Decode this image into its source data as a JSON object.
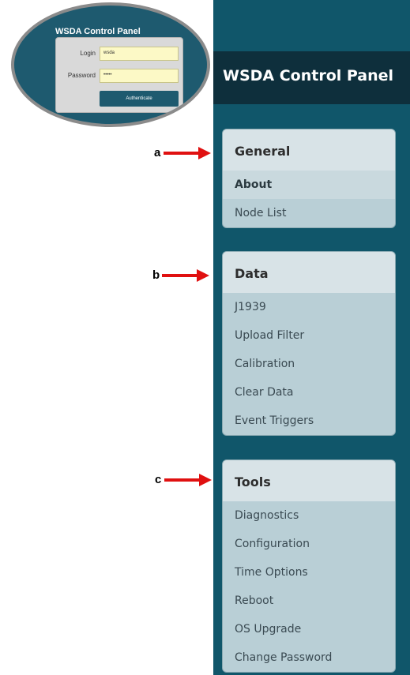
{
  "login_inset": {
    "title": "WSDA Control Panel",
    "login_label": "Login",
    "login_value": "wsda",
    "password_label": "Password",
    "password_value": "•••••",
    "button_label": "Authenticate"
  },
  "panel": {
    "title": "WSDA Control Panel",
    "sections": [
      {
        "heading": "General",
        "items": [
          "About",
          "Node List"
        ]
      },
      {
        "heading": "Data",
        "items": [
          "J1939",
          "Upload Filter",
          "Calibration",
          "Clear Data",
          "Event Triggers"
        ]
      },
      {
        "heading": "Tools",
        "items": [
          "Diagnostics",
          "Configuration",
          "Time Options",
          "Reboot",
          "OS Upgrade",
          "Change Password"
        ]
      }
    ]
  },
  "annotations": [
    "a",
    "b",
    "c"
  ],
  "colors": {
    "panel_bg": "#10566a",
    "header_bg": "#0e2f3c",
    "card_bg": "#b9cfd6",
    "card_head_bg": "#d8e3e7",
    "arrow": "#e01010"
  }
}
